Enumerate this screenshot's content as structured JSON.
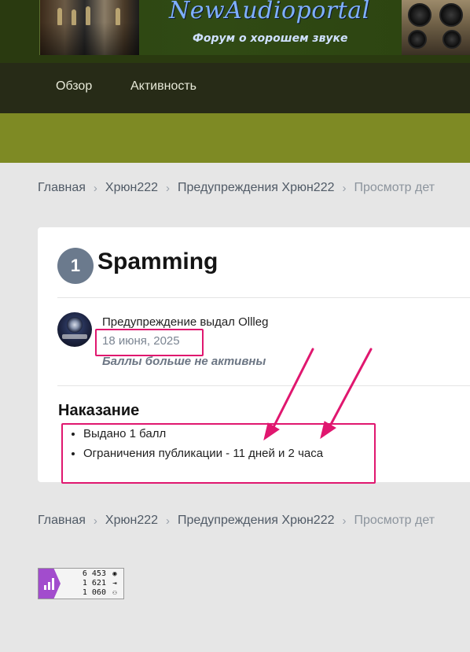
{
  "header": {
    "site_title": "NewAudioportal",
    "site_subtitle": "Форум о хорошем звуке"
  },
  "nav": {
    "items": [
      {
        "label": "Обзор"
      },
      {
        "label": "Активность"
      }
    ]
  },
  "breadcrumb": {
    "items": [
      "Главная",
      "Хрюн222",
      "Предупреждения Хрюн222",
      "Просмотр дет"
    ]
  },
  "warning": {
    "points_badge": "1",
    "title": "Spamming",
    "issued_by": "Предупреждение выдал Ollleg",
    "date": "18 июня, 2025",
    "status": "Баллы больше не активны",
    "section_heading": "Наказание",
    "penalties": [
      "Выдано 1 балл",
      "Ограничения публикации - 11 дней и 2 часа"
    ]
  },
  "counter": {
    "rows": [
      {
        "value": "6 453",
        "icon": "eye-icon"
      },
      {
        "value": "1 621",
        "icon": "login-icon"
      },
      {
        "value": "1 060",
        "icon": "person-icon"
      }
    ]
  },
  "colors": {
    "accent_green": "#7e8a24",
    "nav_dark": "#272b17",
    "annotation_pink": "#e0176f",
    "badge_slate": "#6b7a8d",
    "counter_purple": "#a24ccd"
  }
}
